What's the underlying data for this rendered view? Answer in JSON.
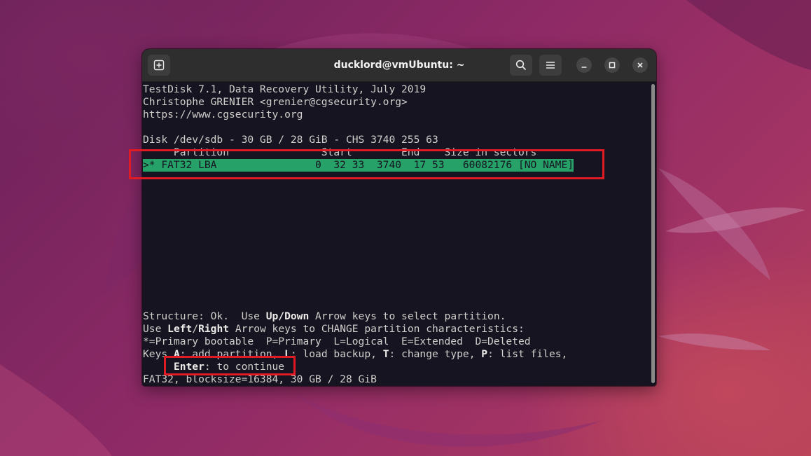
{
  "window": {
    "title": "ducklord@vmUbuntu: ~",
    "new_tab_icon": "new-tab-icon",
    "search_icon": "search-icon",
    "menu_icon": "hamburger-menu-icon",
    "minimize_icon": "minimize-icon",
    "maximize_icon": "maximize-icon",
    "close_icon": "close-icon"
  },
  "terminal": {
    "header_line1": "TestDisk 7.1, Data Recovery Utility, July 2019",
    "header_line2": "Christophe GRENIER <grenier@cgsecurity.org>",
    "header_line3": "https://www.cgsecurity.org",
    "disk_info": "Disk /dev/sdb - 30 GB / 28 GiB - CHS 3740 255 63",
    "table_header": "     Partition               Start        End    Size in sectors",
    "selected_row": ">* FAT32 LBA                0  32 33  3740  17 53   60082176 [NO NAME]",
    "status": {
      "structure_prefix": "Structure: Ok.  Use ",
      "updown_key": "Up/Down",
      "structure_suffix": " Arrow keys to select partition.",
      "use_prefix": "Use ",
      "left_key": "Left",
      "slash": "/",
      "right_key": "Right",
      "use_suffix": " Arrow keys to CHANGE partition characteristics:",
      "legend": "*=Primary bootable  P=Primary  L=Logical  E=Extended  D=Deleted",
      "keys_prefix": "Keys ",
      "key_a": "A",
      "keys_a_text": ": add partition, ",
      "key_l": "L",
      "keys_l_text": ": load backup, ",
      "key_t": "T",
      "keys_t_text": ": change type, ",
      "key_p": "P",
      "keys_p_text": ": list files,",
      "enter_indent": "     ",
      "enter_key": "Enter",
      "enter_text": ": to continue",
      "fs_info": "FAT32, blocksize=16384, 30 GB / 28 GiB"
    }
  },
  "colors": {
    "terminal_bg": "#171421",
    "selection": "#26a269",
    "annotation": "#e01b24"
  }
}
